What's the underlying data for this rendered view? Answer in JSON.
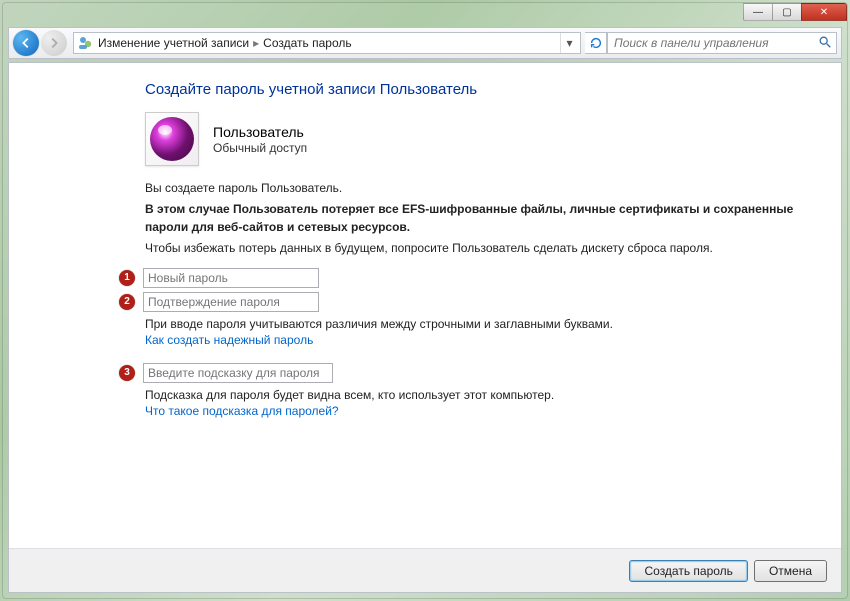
{
  "titlebar": {
    "minimize": "—",
    "maximize": "▢",
    "close": "✕"
  },
  "breadcrumb": {
    "item1": "Изменение учетной записи",
    "item2": "Создать пароль"
  },
  "search": {
    "placeholder": "Поиск в панели управления"
  },
  "heading": "Создайте пароль учетной записи Пользователь",
  "user": {
    "name": "Пользователь",
    "type": "Обычный доступ"
  },
  "text": {
    "intro": "Вы создаете пароль Пользователь.",
    "warning": "В этом случае Пользователь потеряет все EFS-шифрованные файлы, личные сертификаты и сохраненные пароли для веб-сайтов и сетевых ресурсов.",
    "advice": "Чтобы избежать потерь данных в будущем, попросите Пользователь сделать дискету сброса пароля.",
    "case_note": "При вводе пароля учитываются различия между строчными и заглавными буквами.",
    "hint_note": "Подсказка для пароля будет видна всем, кто использует этот компьютер."
  },
  "fields": {
    "new_password_placeholder": "Новый пароль",
    "confirm_password_placeholder": "Подтверждение пароля",
    "hint_placeholder": "Введите подсказку для пароля"
  },
  "links": {
    "strong_pw": "Как создать надежный пароль",
    "what_hint": "Что такое подсказка для паролей?"
  },
  "badges": {
    "b1": "1",
    "b2": "2",
    "b3": "3"
  },
  "buttons": {
    "create": "Создать пароль",
    "cancel": "Отмена"
  }
}
